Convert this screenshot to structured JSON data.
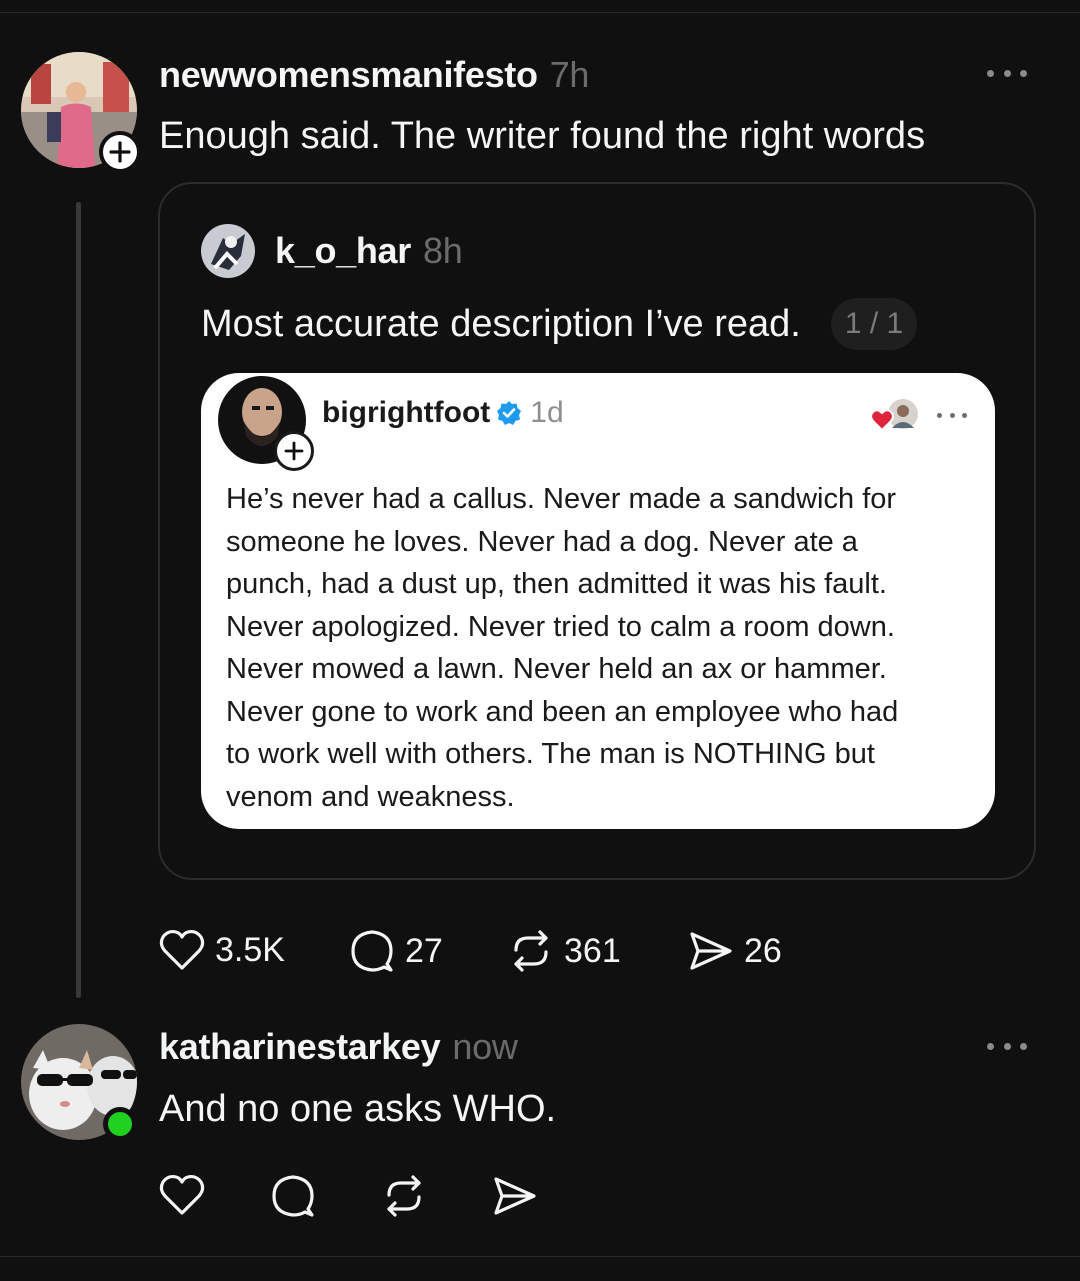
{
  "post": {
    "username": "newwomensmanifesto",
    "time": "7h",
    "text": "Enough said. The writer found the right words",
    "quoted": {
      "username": "k_o_har",
      "time": "8h",
      "text": "Most accurate description I’ve read.",
      "page": "1 / 1",
      "embedded": {
        "username": "bigrightfoot",
        "time": "1d",
        "verified": true,
        "lines": [
          "He’s never had a callus.  Never made a sandwich for",
          "someone he loves.  Never had a dog.  Never ate a",
          "punch, had a dust up, then admitted it was his fault.",
          "Never apologized.  Never tried to calm a room down.",
          "Never mowed a lawn.  Never held an ax or hammer.",
          "Never gone to work and been an employee who had",
          "to work well with others.  The man is NOTHING but",
          "venom and weakness."
        ]
      }
    },
    "actions": {
      "likes": "3.5K",
      "replies": "27",
      "reposts": "361",
      "shares": "26"
    }
  },
  "reply": {
    "username": "katharinestarkey",
    "time": "now",
    "text": "And no one asks WHO.",
    "online": true
  },
  "colors": {
    "background": "#101010",
    "text": "#f3f5f7",
    "muted": "#6b6b6b",
    "verified": "#1d9bf0",
    "online": "#1fd01f",
    "heart_red": "#e0243c"
  }
}
